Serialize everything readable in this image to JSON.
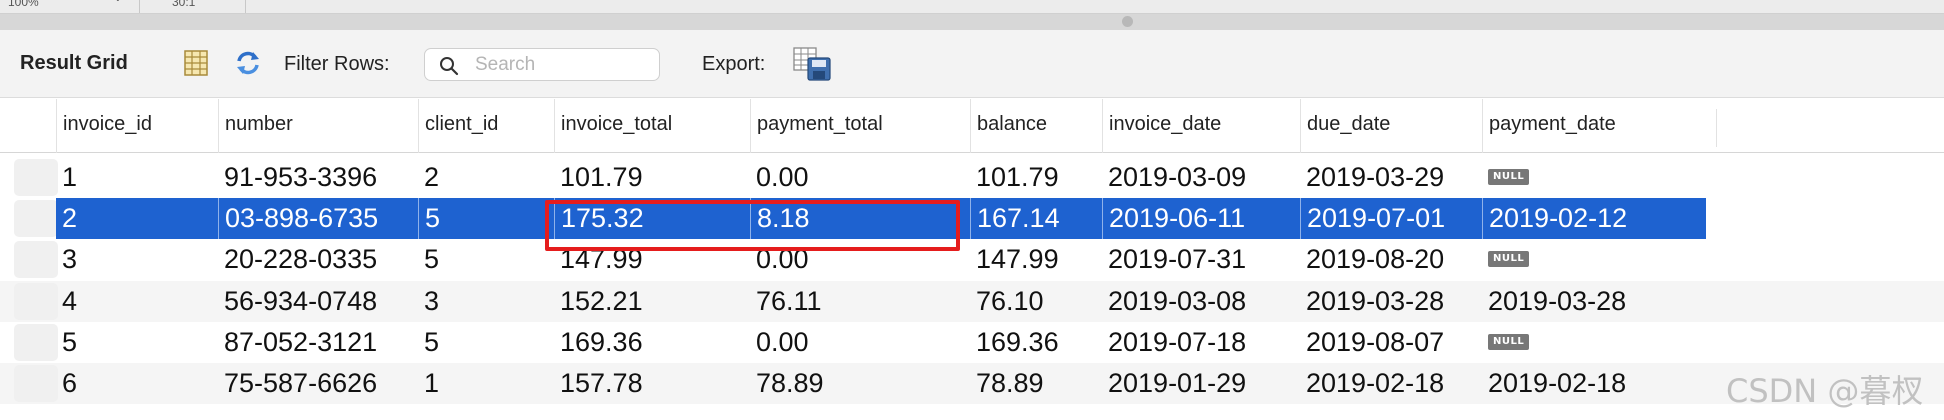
{
  "topbar": {
    "zoom": "100%",
    "limit": "30:1"
  },
  "toolbar": {
    "title": "Result Grid",
    "filter_label": "Filter Rows:",
    "search_placeholder": "Search",
    "export_label": "Export:",
    "icons": {
      "grid": "form-editor-icon",
      "refresh": "refresh-icon",
      "search": "search-icon",
      "export": "export-icon"
    }
  },
  "grid": {
    "columns": [
      "invoice_id",
      "number",
      "client_id",
      "invoice_total",
      "payment_total",
      "balance",
      "invoice_date",
      "due_date",
      "payment_date"
    ],
    "null_label": "NULL",
    "rows": [
      [
        "1",
        "91-953-3396",
        "2",
        "101.79",
        "0.00",
        "101.79",
        "2019-03-09",
        "2019-03-29",
        null
      ],
      [
        "2",
        "03-898-6735",
        "5",
        "175.32",
        "8.18",
        "167.14",
        "2019-06-11",
        "2019-07-01",
        "2019-02-12"
      ],
      [
        "3",
        "20-228-0335",
        "5",
        "147.99",
        "0.00",
        "147.99",
        "2019-07-31",
        "2019-08-20",
        null
      ],
      [
        "4",
        "56-934-0748",
        "3",
        "152.21",
        "76.11",
        "76.10",
        "2019-03-08",
        "2019-03-28",
        "2019-03-28"
      ],
      [
        "5",
        "87-052-3121",
        "5",
        "169.36",
        "0.00",
        "169.36",
        "2019-07-18",
        "2019-08-07",
        null
      ],
      [
        "6",
        "75-587-6626",
        "1",
        "157.78",
        "78.89",
        "78.89",
        "2019-01-29",
        "2019-02-18",
        "2019-02-18"
      ]
    ],
    "selected_row": 1,
    "colors": {
      "selection": "#1e62d0",
      "highlight": "#e51d1d",
      "null_badge": "#777777"
    }
  },
  "watermark": "CSDN @暮杈"
}
